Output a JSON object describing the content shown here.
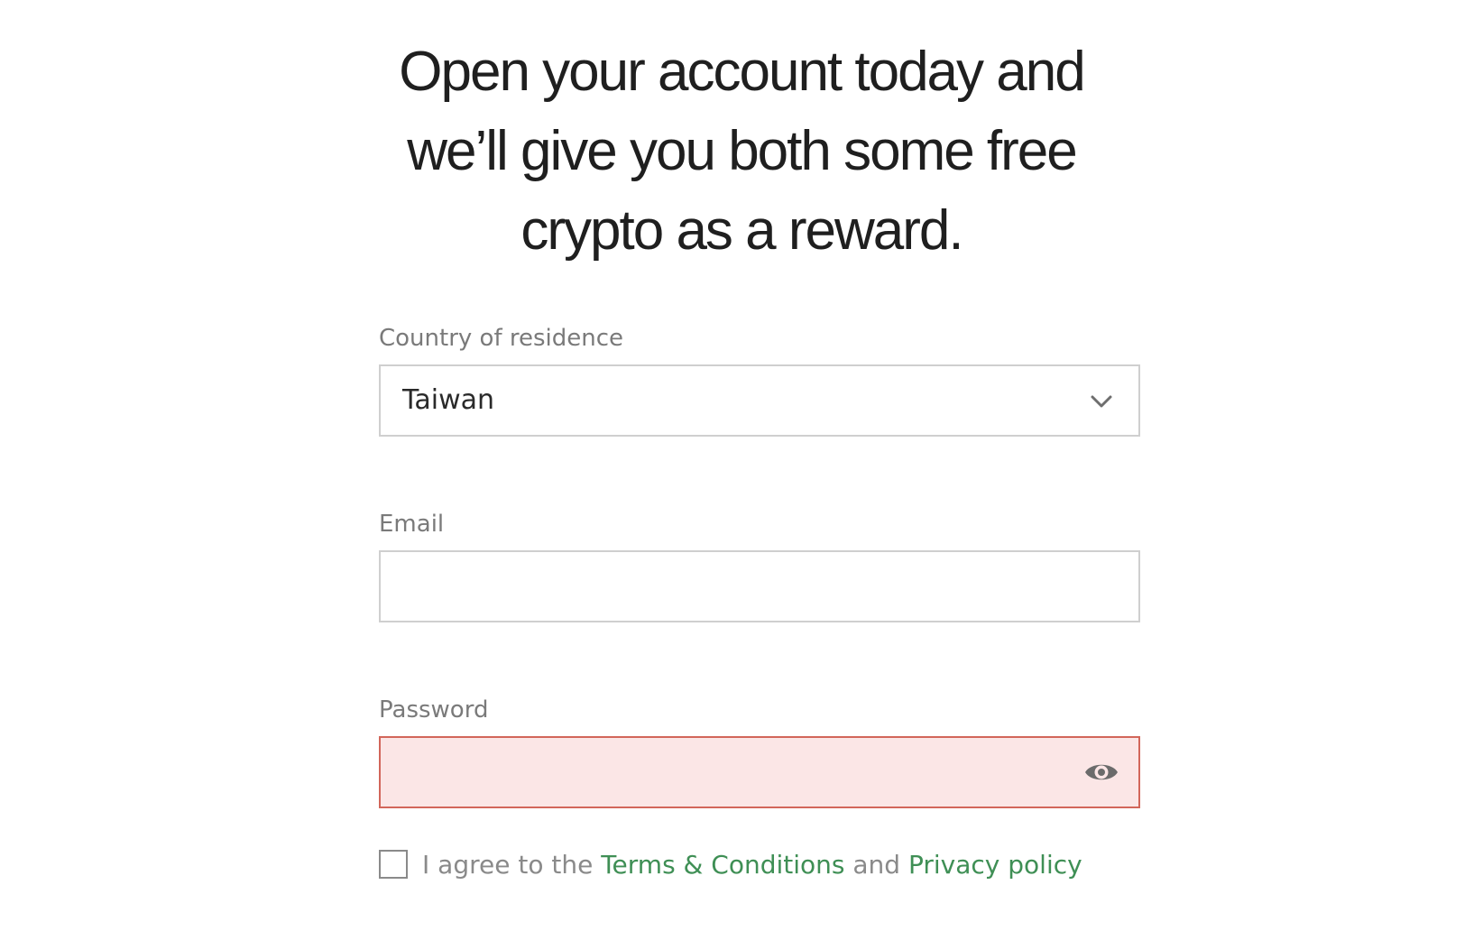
{
  "headline": "Open your account today and we’ll give you both some free crypto as a reward.",
  "form": {
    "country": {
      "label": "Country of residence",
      "value": "Taiwan"
    },
    "email": {
      "label": "Email",
      "value": ""
    },
    "password": {
      "label": "Password",
      "value": "",
      "state": "error"
    },
    "agree": {
      "checked": false,
      "prefix": "I agree to the ",
      "terms_link": "Terms & Conditions",
      "middle": " and ",
      "privacy_link": "Privacy policy"
    }
  },
  "icons": {
    "country_select": "chevron-down-icon",
    "password_toggle": "eye-icon"
  },
  "colors": {
    "heading": "#1f1f1f",
    "label": "#7a7a7a",
    "link": "#3f8f55",
    "error_border": "#d2665a",
    "error_background": "#fbe6e6"
  }
}
